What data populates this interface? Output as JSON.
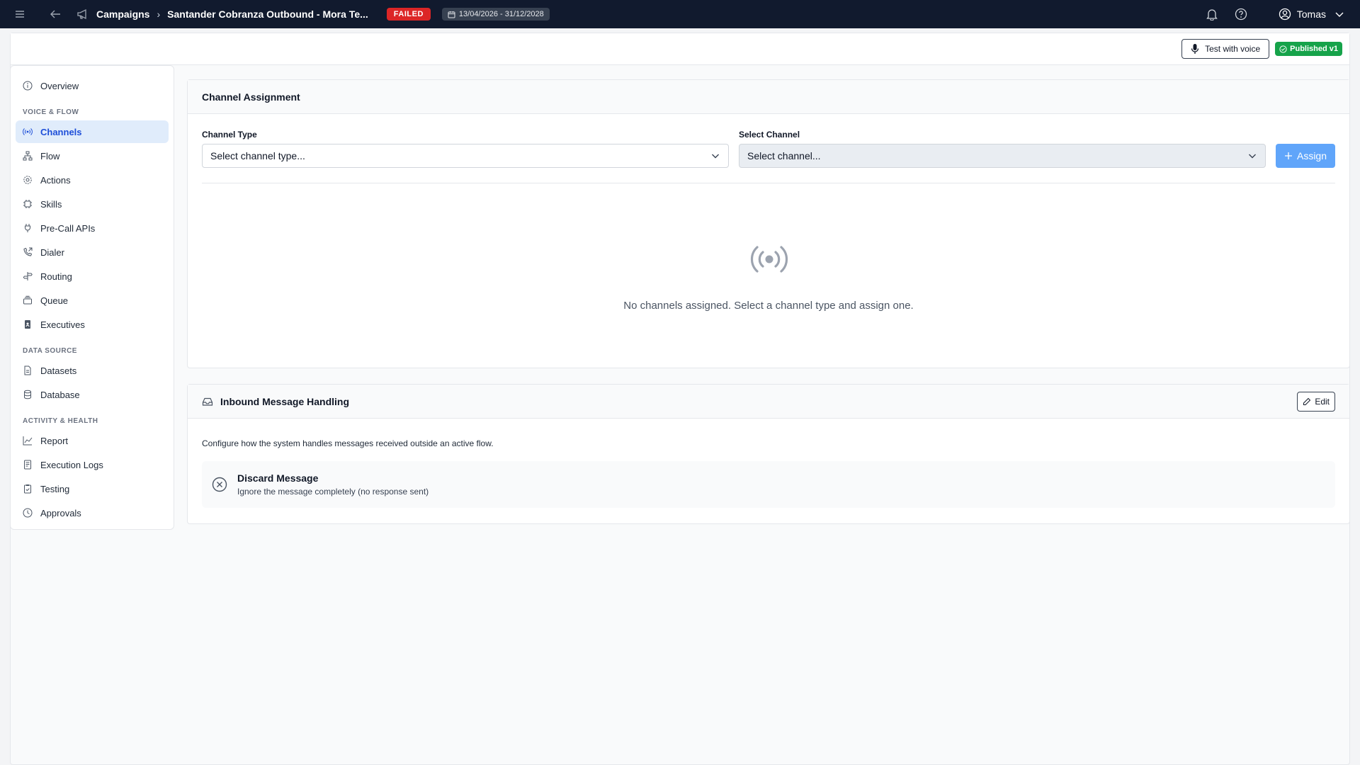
{
  "topbar": {
    "breadcrumb_root": "Campaigns",
    "breadcrumb_separator": "›",
    "campaign_name": "Santander Cobranza Outbound - Mora Te...",
    "status": "FAILED",
    "date_range": "13/04/2026 - 31/12/2028",
    "user_name": "Tomas"
  },
  "header": {
    "test_voice_label": "Test with voice",
    "published_label": "Published v1"
  },
  "sidebar": {
    "overview": "Overview",
    "sections": {
      "voice_flow": "VOICE & FLOW",
      "data_source": "DATA SOURCE",
      "activity_health": "ACTIVITY & HEALTH"
    },
    "items": {
      "channels": "Channels",
      "flow": "Flow",
      "actions": "Actions",
      "skills": "Skills",
      "precall": "Pre-Call APIs",
      "dialer": "Dialer",
      "routing": "Routing",
      "queue": "Queue",
      "executives": "Executives",
      "datasets": "Datasets",
      "database": "Database",
      "report": "Report",
      "execution_logs": "Execution Logs",
      "testing": "Testing",
      "approvals": "Approvals"
    },
    "active_item": "Channels"
  },
  "channel_assignment": {
    "title": "Channel Assignment",
    "channel_type_label": "Channel Type",
    "channel_type_placeholder": "Select channel type...",
    "select_channel_label": "Select Channel",
    "select_channel_placeholder": "Select channel...",
    "assign_label": "Assign",
    "empty_message": "No channels assigned. Select a channel type and assign one."
  },
  "inbound": {
    "title": "Inbound Message Handling",
    "edit_label": "Edit",
    "description": "Configure how the system handles messages received outside an active flow.",
    "option_title": "Discard Message",
    "option_description": "Ignore the message completely (no response sent)"
  },
  "colors": {
    "topbar_bg": "#111a2e",
    "status_failed": "#dc2626",
    "published_green": "#16a34a",
    "active_blue": "#1d4ed8",
    "assign_button": "#60a5fa"
  }
}
